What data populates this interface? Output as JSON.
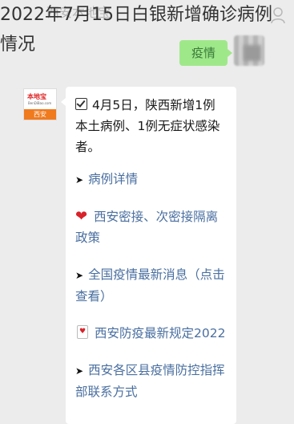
{
  "headline": "2022年7月15日白银新增确诊病例情况",
  "ghost_title": "西安本地宝",
  "my_message": "疫情",
  "bot": {
    "logo_text": "本地宝",
    "logo_domain": "BenDiBao.com",
    "logo_city": "西安"
  },
  "messages": [
    {
      "icon": "check-box",
      "text": "4月5日，陕西新增1例本土病例、1例无症状感染者。",
      "is_link": false
    },
    {
      "icon": "arrow",
      "text": "病例详情",
      "is_link": true
    },
    {
      "icon": "heart",
      "text": "西安密接、次密接隔离政策",
      "is_link": true
    },
    {
      "icon": "arrow",
      "text": "全国疫情最新消息（点击查看）",
      "is_link": true
    },
    {
      "icon": "card",
      "text": "西安防疫最新规定2022",
      "is_link": true
    },
    {
      "icon": "arrow",
      "text": "西安各区县疫情防控指挥部联系方式",
      "is_link": true
    }
  ],
  "colors": {
    "background": "#ececec",
    "my_bubble": "#9fe88a",
    "link": "#4a6fa0",
    "logo_orange": "#f07a1e"
  }
}
